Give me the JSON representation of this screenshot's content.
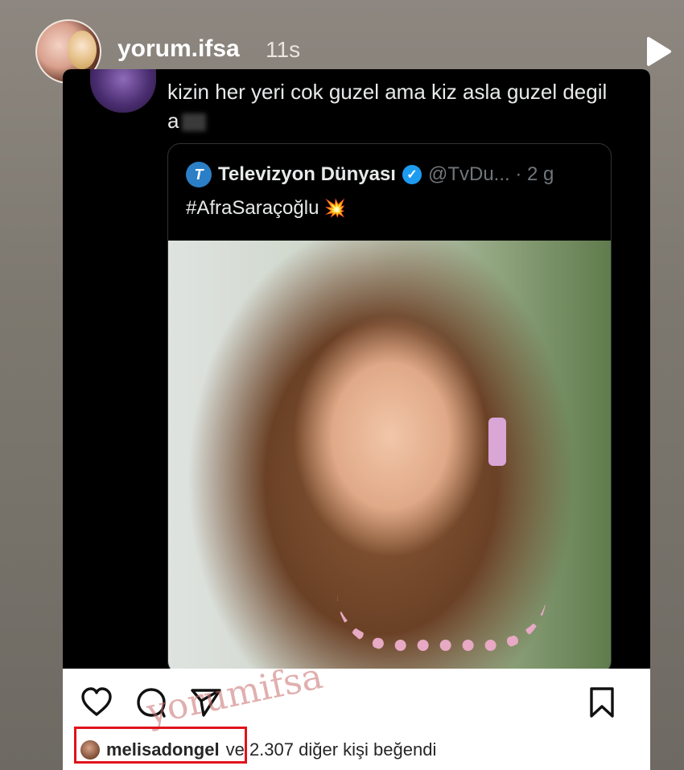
{
  "story": {
    "username": "yorum.ifsa",
    "time_ago": "11s"
  },
  "reply": {
    "text": "kizin her yeri cok guzel ama kiz asla guzel degil a"
  },
  "quoted_tweet": {
    "logo_letter": "T",
    "name": "Televizyon Dünyası",
    "verified_mark": "✓",
    "handle_time": "@TvDu... · 2 g",
    "hashtag": "#AfraSaraçoğlu",
    "emoji": "💥"
  },
  "post": {
    "watermark": "yorumifsa",
    "liked_by_user": "melisadongel",
    "likes_rest": "ve 2.307 diğer kişi beğendi"
  },
  "icons": {
    "play": "play-icon",
    "like": "heart-icon",
    "comment": "comment-icon",
    "share": "send-icon",
    "save": "bookmark-icon"
  },
  "colors": {
    "highlight": "#e0131b",
    "verified": "#1d9bf0"
  }
}
